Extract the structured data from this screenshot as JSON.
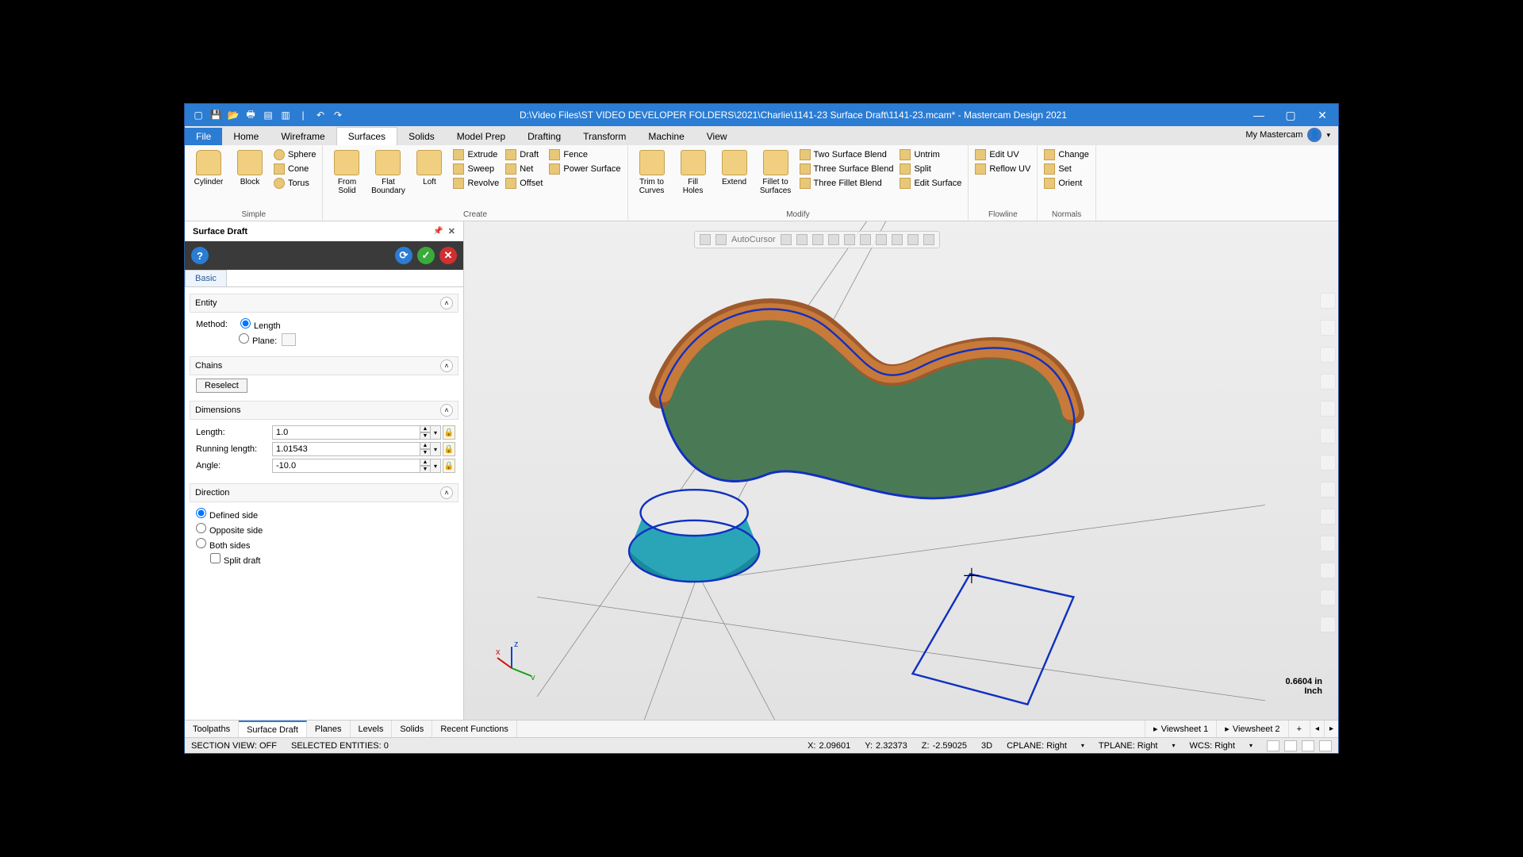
{
  "title_bar": {
    "path": "D:\\Video Files\\ST VIDEO DEVELOPER FOLDERS\\2021\\Charlie\\1141-23 Surface Draft\\1141-23.mcam* - Mastercam Design 2021"
  },
  "menu": {
    "file": "File",
    "tabs": [
      "Home",
      "Wireframe",
      "Surfaces",
      "Solids",
      "Model Prep",
      "Drafting",
      "Transform",
      "Machine",
      "View"
    ],
    "active_index": 2,
    "my_mastercam": "My Mastercam"
  },
  "ribbon": {
    "groups": {
      "simple": {
        "label": "Simple",
        "cylinder": "Cylinder",
        "block": "Block",
        "sphere": "Sphere",
        "cone": "Cone",
        "torus": "Torus"
      },
      "create": {
        "label": "Create",
        "from_solid": "From\nSolid",
        "flat_boundary": "Flat\nBoundary",
        "loft": "Loft",
        "extrude": "Extrude",
        "sweep": "Sweep",
        "revolve": "Revolve",
        "draft": "Draft",
        "net": "Net",
        "offset": "Offset",
        "fence": "Fence",
        "power_surface": "Power Surface"
      },
      "modify": {
        "label": "Modify",
        "trim_curves": "Trim to\nCurves",
        "fill_holes": "Fill\nHoles",
        "extend": "Extend",
        "fillet_surfaces": "Fillet to\nSurfaces",
        "two_blend": "Two Surface Blend",
        "three_blend": "Three Surface Blend",
        "three_fillet": "Three Fillet Blend",
        "untrim": "Untrim",
        "split": "Split",
        "edit_surface": "Edit Surface"
      },
      "flowline": {
        "label": "Flowline",
        "edit_uv": "Edit UV",
        "reflow_uv": "Reflow UV"
      },
      "normals": {
        "label": "Normals",
        "change": "Change",
        "set": "Set",
        "orient": "Orient"
      }
    }
  },
  "panel": {
    "title": "Surface Draft",
    "tab_basic": "Basic",
    "entity": {
      "header": "Entity",
      "method_label": "Method:",
      "length": "Length",
      "plane": "Plane:"
    },
    "chains": {
      "header": "Chains",
      "reselect": "Reselect"
    },
    "dimensions": {
      "header": "Dimensions",
      "length_label": "Length:",
      "length_val": "1.0",
      "running_label": "Running length:",
      "running_val": "1.01543",
      "angle_label": "Angle:",
      "angle_val": "-10.0"
    },
    "direction": {
      "header": "Direction",
      "defined": "Defined side",
      "opposite": "Opposite side",
      "both": "Both sides",
      "split": "Split draft"
    }
  },
  "floating_toolbar": {
    "autocursor": "AutoCursor"
  },
  "scale": {
    "value": "0.6604 in",
    "unit": "Inch"
  },
  "bottom_tabs": {
    "toolpaths": "Toolpaths",
    "surface_draft": "Surface Draft",
    "planes": "Planes",
    "levels": "Levels",
    "solids": "Solids",
    "recent": "Recent Functions",
    "viewsheet1": "Viewsheet 1",
    "viewsheet2": "Viewsheet 2"
  },
  "status": {
    "section": "SECTION VIEW: OFF",
    "selected": "SELECTED ENTITIES: 0",
    "x_label": "X:",
    "x": "2.09601",
    "y_label": "Y:",
    "y": "2.32373",
    "z_label": "Z:",
    "z": "-2.59025",
    "mode": "3D",
    "cplane": "CPLANE: Right",
    "tplane": "TPLANE: Right",
    "wcs": "WCS: Right"
  }
}
